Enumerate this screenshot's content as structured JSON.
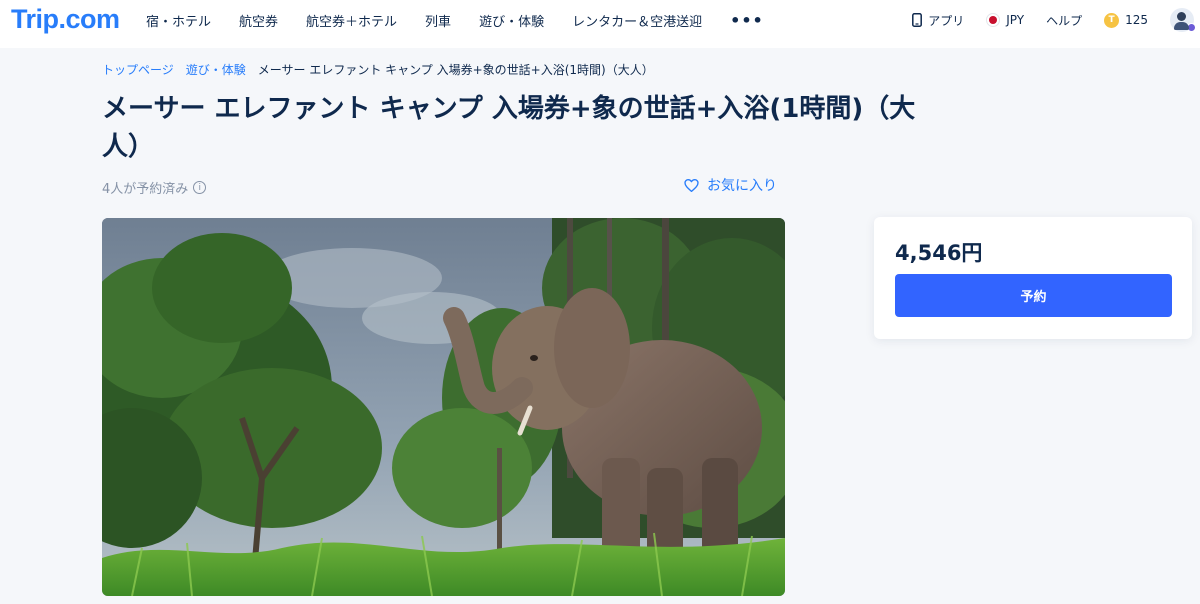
{
  "header": {
    "logo": "Trip.com",
    "nav": [
      {
        "label": "宿・ホテル"
      },
      {
        "label": "航空券"
      },
      {
        "label": "航空券＋ホテル"
      },
      {
        "label": "列車"
      },
      {
        "label": "遊び・体験"
      },
      {
        "label": "レンタカー＆空港送迎"
      }
    ],
    "more_label": "•••",
    "app_label": "アプリ",
    "currency_label": "JPY",
    "help_label": "ヘルプ",
    "points_value": "125",
    "coin_symbol": "T"
  },
  "breadcrumb": {
    "items": [
      "トップページ",
      "遊び・体験"
    ],
    "current": "メーサー エレファント キャンプ 入場券+象の世話+入浴(1時間)（大人）"
  },
  "product": {
    "title": "メーサー エレファント キャンプ 入場券+象の世話+入浴(1時間)（大人）",
    "booked_text": "4人が予約済み",
    "info_glyph": "i",
    "favorite_label": "お気に入り"
  },
  "booking": {
    "price": "4,546円",
    "book_label": "予約"
  },
  "colors": {
    "brand": "#287dfa",
    "button": "#3264ff",
    "text": "#0f294d"
  }
}
